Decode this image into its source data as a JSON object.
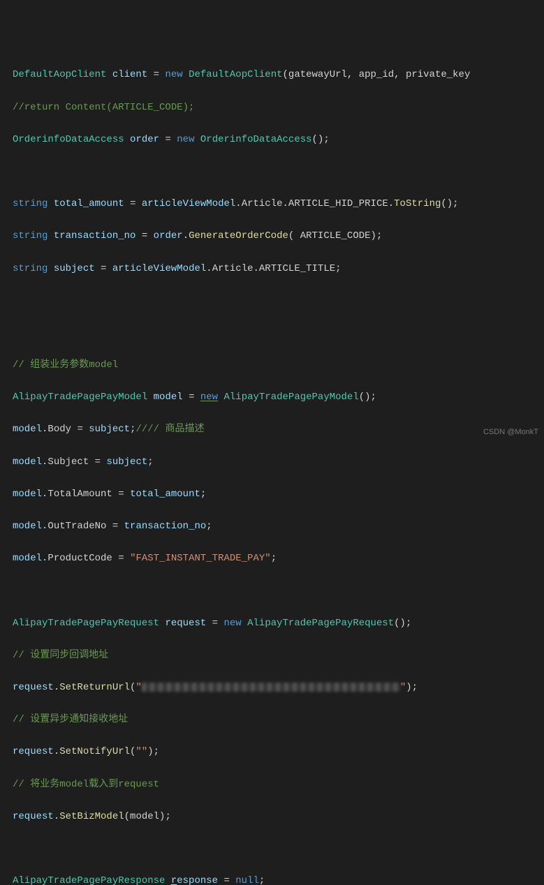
{
  "lines": {
    "l1_type1": "DefaultAopClient",
    "l1_var1": "client",
    "l1_op": "=",
    "l1_kw": "new",
    "l1_type2": "DefaultAopClient",
    "l1_args": "(gatewayUrl, app_id, private_key",
    "l2_comment": "//return Content(ARTICLE_CODE);",
    "l3_type1": "OrderinfoDataAccess",
    "l3_var1": "order",
    "l3_op": "=",
    "l3_kw": "new",
    "l3_type2": "OrderinfoDataAccess",
    "l3_end": "();",
    "l5_kw": "string",
    "l5_var": "total_amount",
    "l5_eq": "=",
    "l5_obj": "articleViewModel",
    "l5_dot1": ".",
    "l5_p1": "Article",
    "l5_dot2": ".",
    "l5_p2": "ARTICLE_HID_PRICE",
    "l5_dot3": ".",
    "l5_m": "ToString",
    "l5_end": "();",
    "l6_kw": "string",
    "l6_var": "transaction_no",
    "l6_eq": "=",
    "l6_obj": "order",
    "l6_dot": ".",
    "l6_m": "GenerateOrderCode",
    "l6_args": "( ARTICLE_CODE);",
    "l7_kw": "string",
    "l7_var": "subject",
    "l7_eq": "=",
    "l7_obj": "articleViewModel",
    "l7_dot1": ".",
    "l7_p1": "Article",
    "l7_dot2": ".",
    "l7_p2": "ARTICLE_TITLE",
    "l7_end": ";",
    "l9_comment": "// 组装业务参数model",
    "l10_type1": "AlipayTradePagePayModel",
    "l10_var": "model",
    "l10_eq": "=",
    "l10_kw": "new",
    "l10_type2": "AlipayTradePagePayModel",
    "l10_end": "();",
    "l11_obj": "model",
    "l11_dot": ".",
    "l11_p": "Body",
    "l11_eq": "=",
    "l11_val": "subject",
    "l11_end": ";",
    "l11_comment": "//// 商品描述",
    "l12_obj": "model",
    "l12_dot": ".",
    "l12_p": "Subject",
    "l12_eq": "=",
    "l12_val": "subject",
    "l12_end": ";",
    "l13_obj": "model",
    "l13_dot": ".",
    "l13_p": "TotalAmount",
    "l13_eq": "=",
    "l13_val": "total_amount",
    "l13_end": ";",
    "l14_obj": "model",
    "l14_dot": ".",
    "l14_p": "OutTradeNo",
    "l14_eq": "=",
    "l14_val": "transaction_no",
    "l14_end": ";",
    "l15_obj": "model",
    "l15_dot": ".",
    "l15_p": "ProductCode",
    "l15_eq": "=",
    "l15_val": "\"FAST_INSTANT_TRADE_PAY\"",
    "l15_end": ";",
    "l17_type1": "AlipayTradePagePayRequest",
    "l17_var": "request",
    "l17_eq": "=",
    "l17_kw": "new",
    "l17_type2": "AlipayTradePagePayRequest",
    "l17_end": "();",
    "l18_comment": "// 设置同步回调地址",
    "l19_obj": "request",
    "l19_dot": ".",
    "l19_m": "SetReturnUrl",
    "l19_open": "(",
    "l19_q1": "\"",
    "l19_q2": "\"",
    "l19_close": ");",
    "l20_comment": "// 设置异步通知接收地址",
    "l21_obj": "request",
    "l21_dot": ".",
    "l21_m": "SetNotifyUrl",
    "l21_args": "(",
    "l21_str": "\"\"",
    "l21_end": ");",
    "l22_comment": "// 将业务model载入到request",
    "l23_obj": "request",
    "l23_dot": ".",
    "l23_m": "SetBizModel",
    "l23_args": "(model);",
    "l25_type": "AlipayTradePagePayResponse",
    "l25_var_r": "r",
    "l25_var_rest": "esponse",
    "l25_eq": "=",
    "l25_kw": "null",
    "l25_end": ";"
  },
  "watermark": "CSDN @MonkT"
}
